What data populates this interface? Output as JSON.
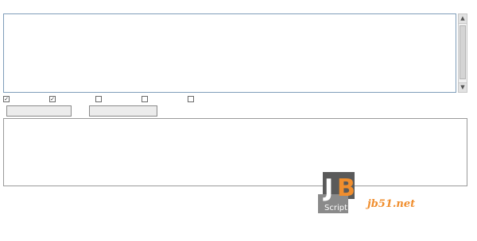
{
  "source": {
    "label": "",
    "example_link": "",
    "text": ""
  },
  "options": [
    {
      "label": "",
      "checked": true
    },
    {
      "label": "",
      "checked": true
    },
    {
      "label": "",
      "checked": false
    },
    {
      "label": "",
      "checked": false
    },
    {
      "label": "",
      "checked": false
    }
  ],
  "buttons": {
    "primary": "",
    "secondary": ""
  },
  "output": {
    "text": ""
  },
  "debug": {
    "title": "",
    "line1": "",
    "line2": "",
    "line3": ""
  },
  "watermark": {
    "logo_text": "Script",
    "site_name": "",
    "domain": "jb51.net",
    "corner": ""
  },
  "colors": {
    "link": "#1f3fa8",
    "status_ok": "#cc3300",
    "watermark_orange": "#f08e2e"
  }
}
